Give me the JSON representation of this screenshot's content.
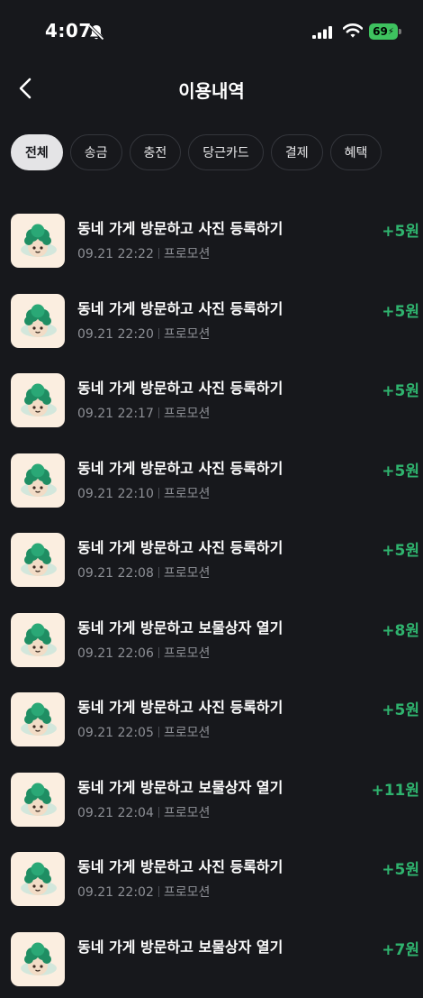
{
  "status_bar": {
    "time": "4:07",
    "battery": "69"
  },
  "header": {
    "title": "이용내역"
  },
  "filters": [
    {
      "label": "전체",
      "active": true
    },
    {
      "label": "송금",
      "active": false
    },
    {
      "label": "충전",
      "active": false
    },
    {
      "label": "당근카드",
      "active": false
    },
    {
      "label": "결제",
      "active": false
    },
    {
      "label": "혜택",
      "active": false
    }
  ],
  "transactions": [
    {
      "title": "동네 가게 방문하고 사진 등록하기",
      "datetime": "09.21 22:22",
      "category": "프로모션",
      "amount": "+5원"
    },
    {
      "title": "동네 가게 방문하고 사진 등록하기",
      "datetime": "09.21 22:20",
      "category": "프로모션",
      "amount": "+5원"
    },
    {
      "title": "동네 가게 방문하고 사진 등록하기",
      "datetime": "09.21 22:17",
      "category": "프로모션",
      "amount": "+5원"
    },
    {
      "title": "동네 가게 방문하고 사진 등록하기",
      "datetime": "09.21 22:10",
      "category": "프로모션",
      "amount": "+5원"
    },
    {
      "title": "동네 가게 방문하고 사진 등록하기",
      "datetime": "09.21 22:08",
      "category": "프로모션",
      "amount": "+5원"
    },
    {
      "title": "동네 가게 방문하고 보물상자 열기",
      "datetime": "09.21 22:06",
      "category": "프로모션",
      "amount": "+8원"
    },
    {
      "title": "동네 가게 방문하고 사진 등록하기",
      "datetime": "09.21 22:05",
      "category": "프로모션",
      "amount": "+5원"
    },
    {
      "title": "동네 가게 방문하고 보물상자 열기",
      "datetime": "09.21 22:04",
      "category": "프로모션",
      "amount": "+11원"
    },
    {
      "title": "동네 가게 방문하고 사진 등록하기",
      "datetime": "09.21 22:02",
      "category": "프로모션",
      "amount": "+5원"
    },
    {
      "title": "동네 가게 방문하고 보물상자 열기",
      "datetime": "",
      "category": "",
      "amount": "+7원"
    }
  ],
  "colors": {
    "background": "#17181c",
    "amount_positive": "#2fb36e",
    "battery": "#3ec25f"
  },
  "icons": [
    "bell-slash-icon",
    "signal-icon",
    "wifi-icon",
    "battery-icon",
    "back-arrow-icon",
    "promotion-mascot-icon"
  ]
}
